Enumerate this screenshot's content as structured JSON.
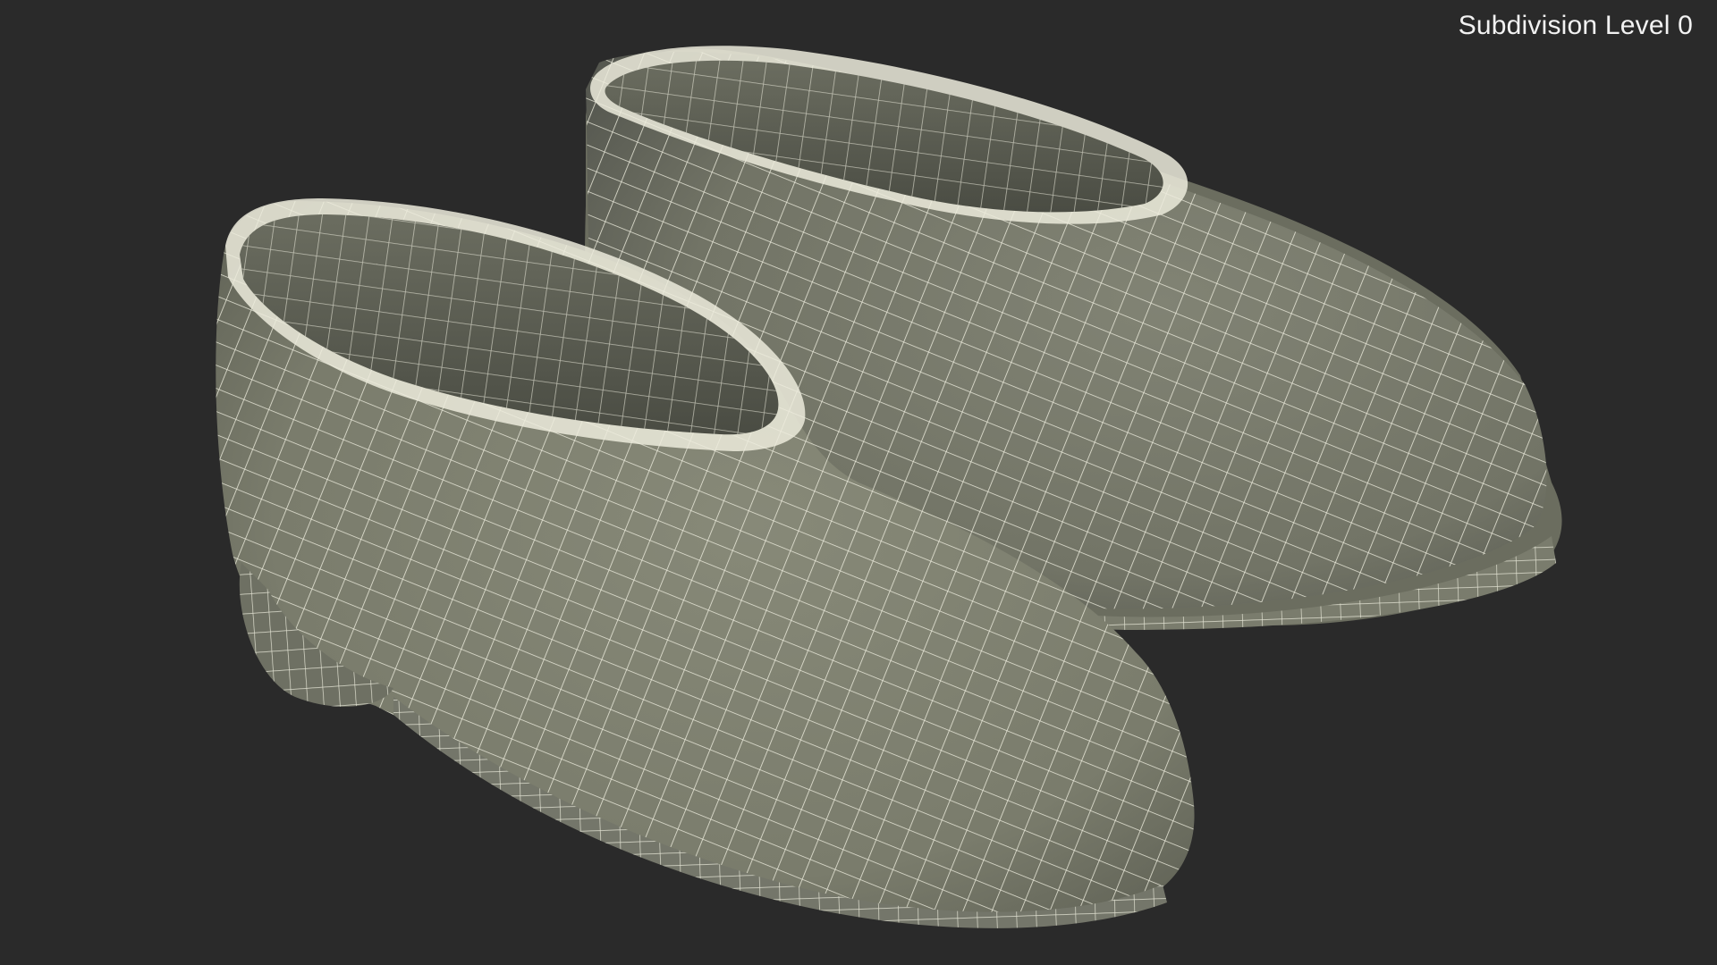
{
  "viewport": {
    "overlay_label": "Subdivision Level 0",
    "background_color": "#2a2a2a"
  },
  "scene": {
    "subject": "pair of shoes wireframe mesh",
    "shoe_fill_color": "#7d7f70",
    "shoe_shadow_color": "#4b4c44",
    "inner_color": "#585a4f",
    "wire_color": "#ecebdc"
  }
}
